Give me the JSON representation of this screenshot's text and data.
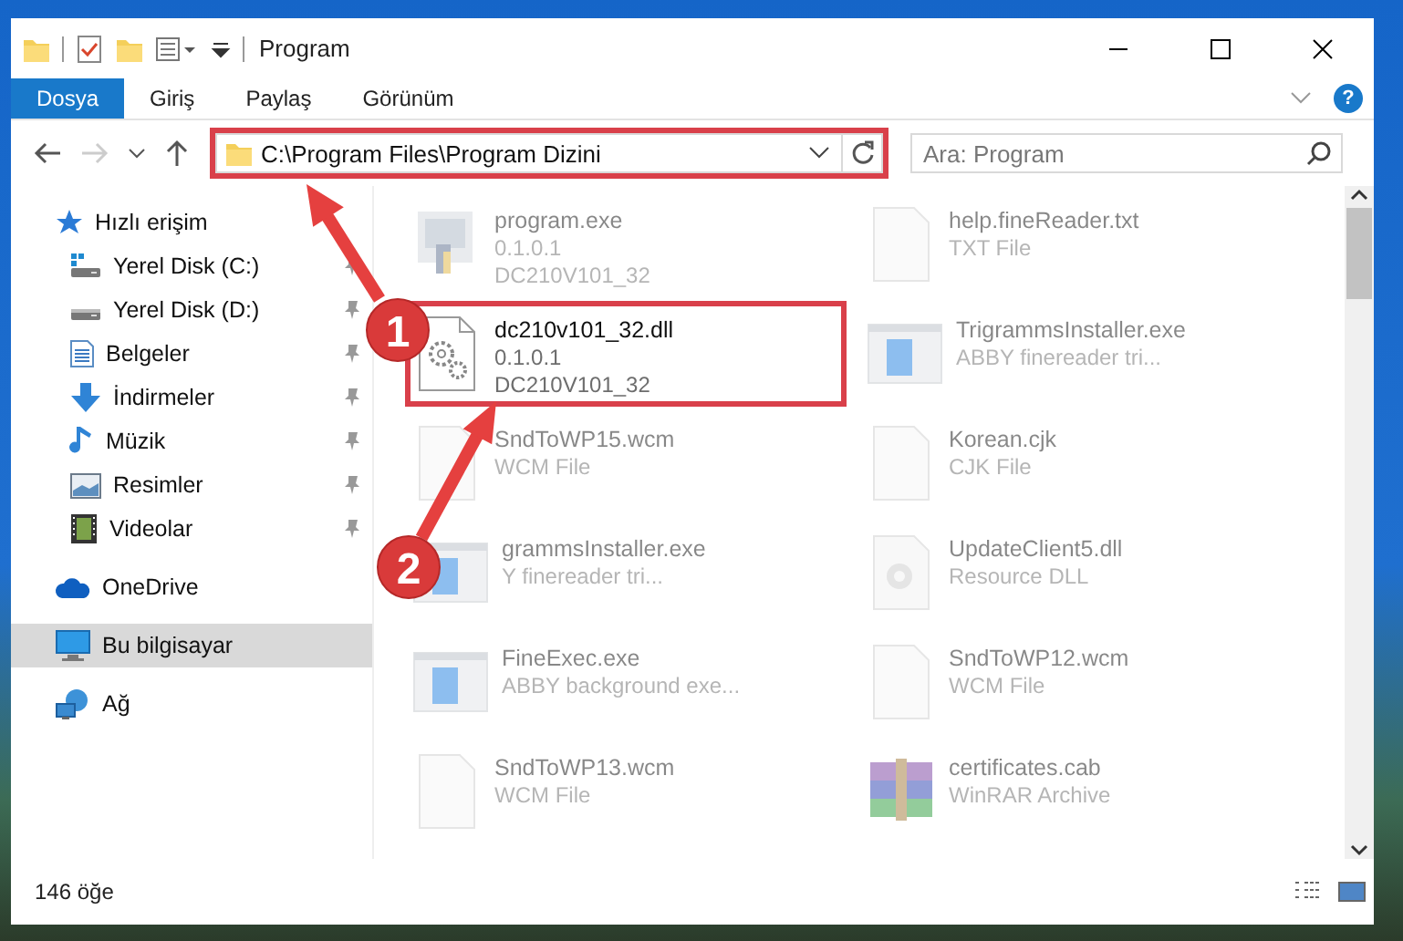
{
  "window": {
    "title": "Program"
  },
  "ribbon_tabs": [
    {
      "label": "Dosya",
      "selected": true
    },
    {
      "label": "Giriş",
      "selected": false
    },
    {
      "label": "Paylaş",
      "selected": false
    },
    {
      "label": "Görünüm",
      "selected": false
    }
  ],
  "help_button": {
    "label": "?"
  },
  "address": {
    "path": "C:\\Program Files\\Program Dizini",
    "highlighted": true
  },
  "search": {
    "placeholder": "Ara: Program"
  },
  "sidebar": {
    "items": [
      {
        "label": "Hızlı erişim",
        "kind": "star",
        "selected": false,
        "children": [
          {
            "label": "Yerel Disk (C:)",
            "kind": "drive-c",
            "pinned": true,
            "selected": false
          },
          {
            "label": "Yerel Disk (D:)",
            "kind": "drive",
            "pinned": true,
            "selected": false
          },
          {
            "label": "Belgeler",
            "kind": "docs",
            "pinned": true,
            "selected": false
          },
          {
            "label": "İndirmeler",
            "kind": "download",
            "pinned": true,
            "selected": false
          },
          {
            "label": "Müzik",
            "kind": "music",
            "pinned": true,
            "selected": false
          },
          {
            "label": "Resimler",
            "kind": "pictures",
            "pinned": true,
            "selected": false
          },
          {
            "label": "Videolar",
            "kind": "videos",
            "pinned": true,
            "selected": false
          }
        ]
      },
      {
        "label": "OneDrive",
        "kind": "cloud",
        "selected": false
      },
      {
        "label": "Bu bilgisayar",
        "kind": "computer",
        "selected": true
      },
      {
        "label": "Ağ",
        "kind": "network",
        "selected": false
      }
    ]
  },
  "files": [
    {
      "name": "program.exe",
      "details": [
        "0.1.0.1",
        "DC210V101_32"
      ],
      "kind": "program",
      "dimmed": true,
      "highlighted": false
    },
    {
      "name": "help.fineReader.txt",
      "details": [
        "TXT File"
      ],
      "kind": "page",
      "dimmed": true,
      "highlighted": false
    },
    {
      "name": "dc210v101_32.dll",
      "details": [
        "0.1.0.1",
        "DC210V101_32"
      ],
      "kind": "gears",
      "dimmed": false,
      "highlighted": true
    },
    {
      "name": "TrigrammsInstaller.exe",
      "details": [
        "ABBY finereader tri..."
      ],
      "kind": "app",
      "dimmed": true,
      "highlighted": false
    },
    {
      "name": "SndToWP15.wcm",
      "details": [
        "WCM File"
      ],
      "kind": "page",
      "dimmed": true,
      "highlighted": false
    },
    {
      "name": "Korean.cjk",
      "details": [
        "CJK File"
      ],
      "kind": "page",
      "dimmed": true,
      "highlighted": false
    },
    {
      "name": "grammsInstaller.exe",
      "details": [
        "Y finereader tri..."
      ],
      "kind": "app",
      "dimmed": true,
      "highlighted": false
    },
    {
      "name": "UpdateClient5.dll",
      "details": [
        "Resource DLL"
      ],
      "kind": "dll",
      "dimmed": true,
      "highlighted": false
    },
    {
      "name": "FineExec.exe",
      "details": [
        "ABBY background exe..."
      ],
      "kind": "app",
      "dimmed": true,
      "highlighted": false
    },
    {
      "name": "SndToWP12.wcm",
      "details": [
        "WCM File"
      ],
      "kind": "page",
      "dimmed": true,
      "highlighted": false
    },
    {
      "name": "SndToWP13.wcm",
      "details": [
        "WCM File"
      ],
      "kind": "page",
      "dimmed": true,
      "highlighted": false
    },
    {
      "name": "certificates.cab",
      "details": [
        "WinRAR Archive"
      ],
      "kind": "archive",
      "dimmed": true,
      "highlighted": false
    }
  ],
  "annotations": [
    {
      "number": "1"
    },
    {
      "number": "2"
    }
  ],
  "status_bar": {
    "count": "146 öğe"
  }
}
